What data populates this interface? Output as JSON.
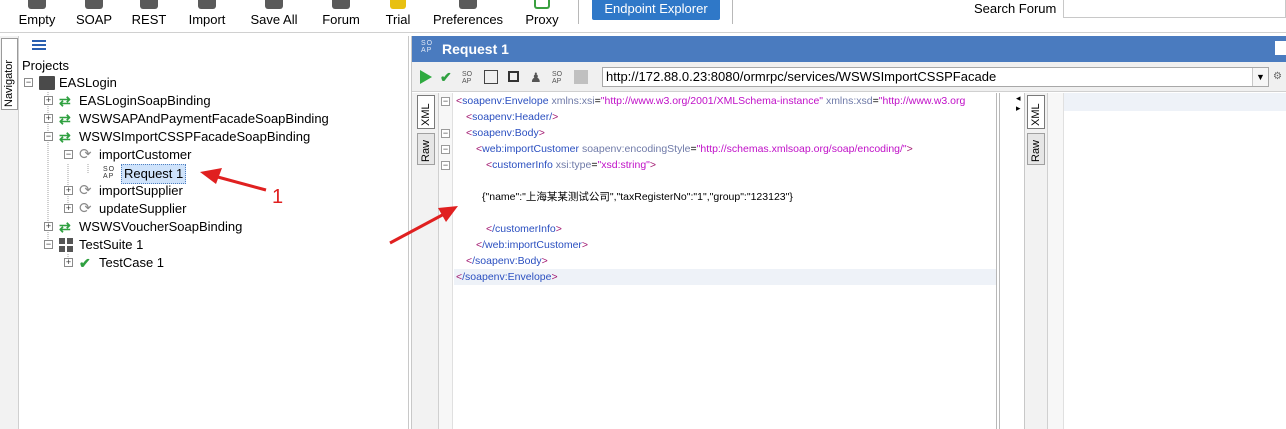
{
  "toolbar": {
    "buttons": [
      {
        "label": "Empty",
        "icon": "empty-icon"
      },
      {
        "label": "SOAP",
        "icon": "soap-icon"
      },
      {
        "label": "REST",
        "icon": "rest-icon"
      },
      {
        "label": "Import",
        "icon": "import-icon"
      },
      {
        "label": "Save All",
        "icon": "save-all-icon"
      },
      {
        "label": "Forum",
        "icon": "forum-icon"
      },
      {
        "label": "Trial",
        "icon": "trial-icon"
      },
      {
        "label": "Preferences",
        "icon": "preferences-icon"
      },
      {
        "label": "Proxy",
        "icon": "proxy-icon"
      }
    ],
    "endpoint_explorer": "Endpoint Explorer",
    "search_forum_label": "Search Forum",
    "search_value": ""
  },
  "navigator": {
    "tab_label": "Navigator"
  },
  "tree": {
    "root_label": "Projects",
    "project": "EASLogin",
    "items": [
      {
        "label": "EASLoginSoapBinding",
        "kind": "binding"
      },
      {
        "label": "WSWSAPAndPaymentFacadeSoapBinding",
        "kind": "binding"
      },
      {
        "label": "WSWSImportCSSPFacadeSoapBinding",
        "kind": "binding"
      },
      {
        "label": "importCustomer",
        "kind": "operation"
      },
      {
        "label": "Request 1",
        "kind": "request"
      },
      {
        "label": "importSupplier",
        "kind": "operation"
      },
      {
        "label": "updateSupplier",
        "kind": "operation"
      },
      {
        "label": "WSWSVoucherSoapBinding",
        "kind": "binding"
      },
      {
        "label": "TestSuite 1",
        "kind": "testsuite"
      },
      {
        "label": "TestCase 1",
        "kind": "testcase"
      }
    ]
  },
  "request": {
    "title": "Request 1",
    "icon_text": "SO AP",
    "url": "http://172.88.0.23:8080/ormrpc/services/WSWSImportCSSPFacade",
    "editor_tabs": [
      "XML",
      "Raw"
    ],
    "response_tabs": [
      "XML",
      "Raw"
    ],
    "xml": {
      "l1_tag": "soapenv:Envelope",
      "l1_a1": "xmlns:xsi",
      "l1_v1": "\"http://www.w3.org/2001/XMLSchema-instance\"",
      "l1_a2": "xmlns:xsd",
      "l1_v2": "\"http://www.w3.org",
      "l2": "soapenv:Header/",
      "l3": "soapenv:Body",
      "l4_tag": "web:importCustomer",
      "l4_a": "soapenv:encodingStyle",
      "l4_v": "\"http://schemas.xmlsoap.org/soap/encoding/\"",
      "l5_tag": "customerInfo",
      "l5_a": "xsi:type",
      "l5_v": "\"xsd:string\"",
      "l6": "{\"name\":\"上海某某测试公司\",\"taxRegisterNo\":\"1\",\"group\":\"123123\"}",
      "l7": "/customerInfo",
      "l8": "/web:importCustomer",
      "l9": "/soapenv:Body",
      "l10": "/soapenv:Envelope"
    }
  },
  "annotation": {
    "number": "1",
    "color": "#e02020"
  },
  "colors": {
    "accent": "#2f78c8",
    "titlebar": "#4a7bbf",
    "green": "#2fa040"
  }
}
